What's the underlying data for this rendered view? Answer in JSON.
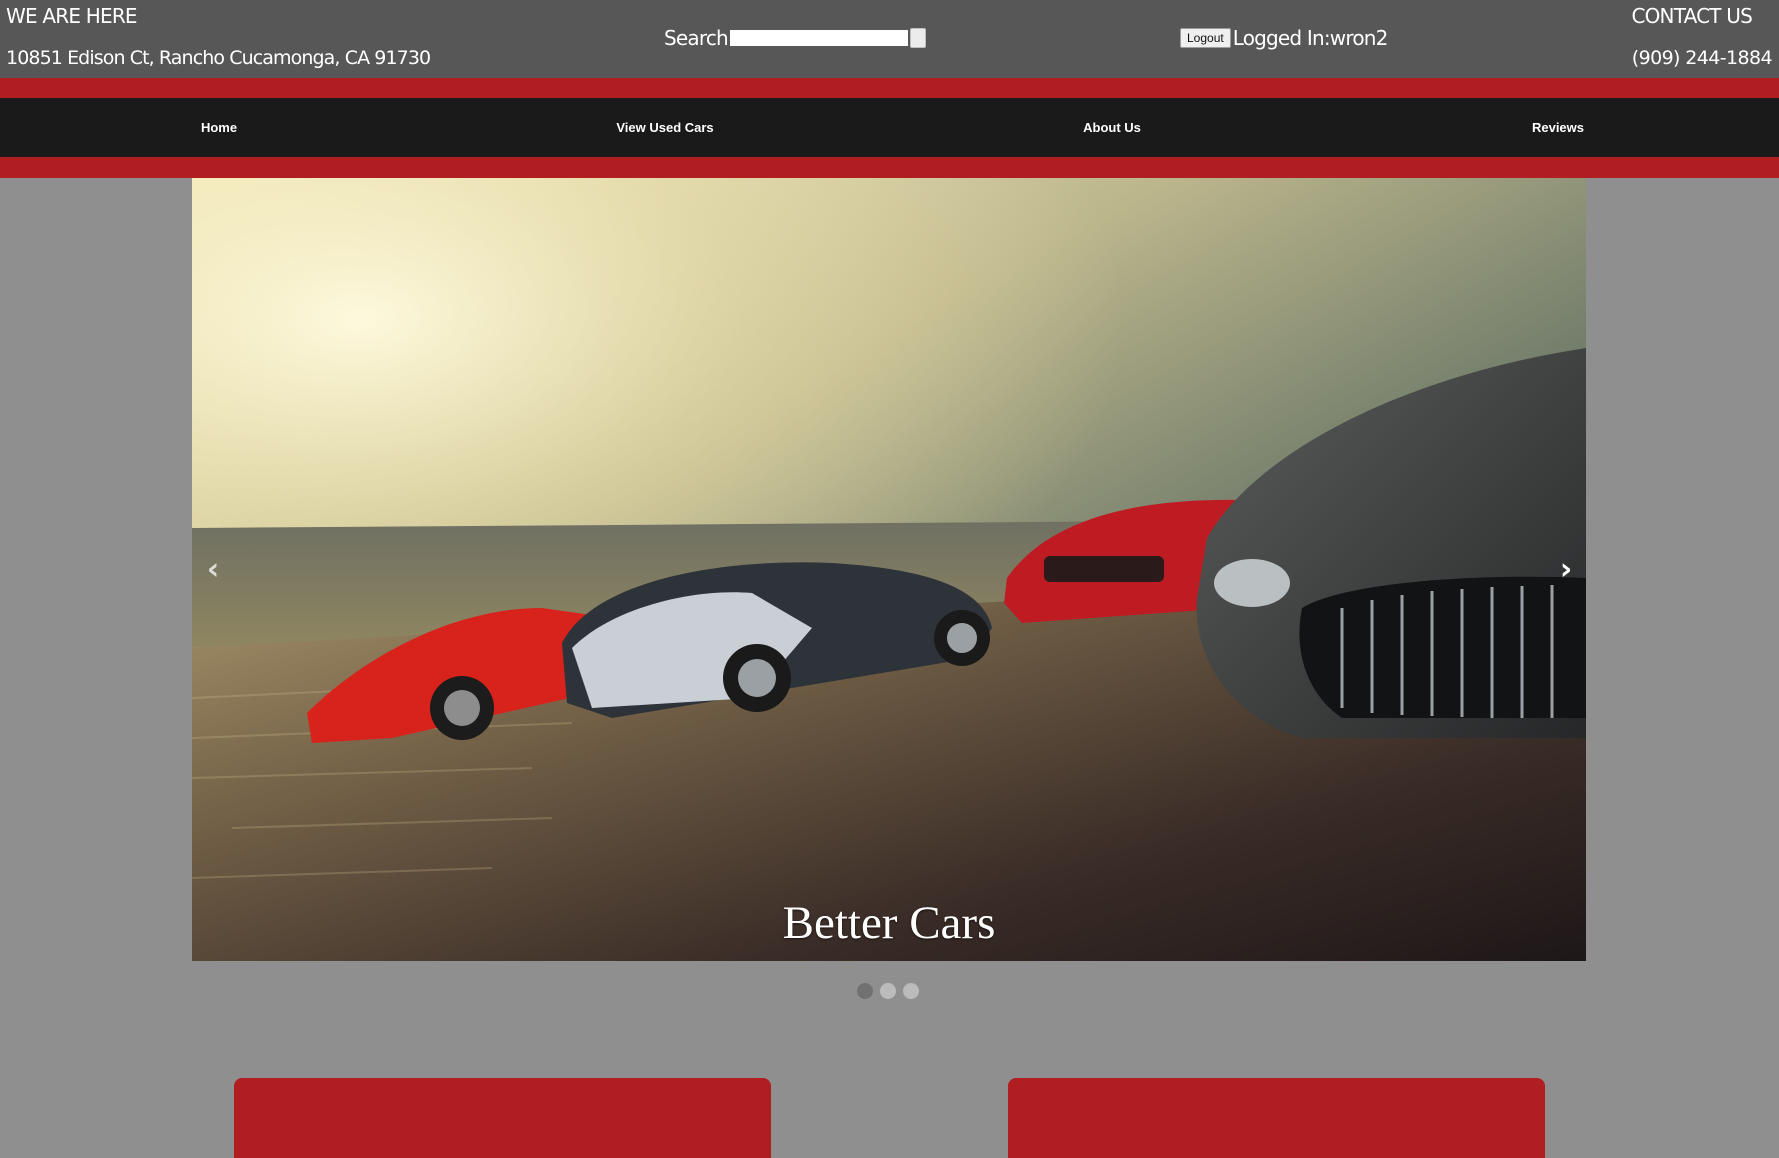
{
  "header": {
    "location_heading": "WE ARE HERE",
    "address": "10851 Edison Ct, Rancho Cucamonga, CA 91730",
    "search_label": "Search",
    "search_value": "",
    "logout_label": "Logout",
    "login_status": "Logged In:wron2",
    "contact_heading": "CONTACT US",
    "phone": "(909) 244-1884"
  },
  "nav": {
    "items": [
      {
        "label": "Home"
      },
      {
        "label": "View Used Cars"
      },
      {
        "label": "About Us"
      },
      {
        "label": "Reviews"
      }
    ]
  },
  "carousel": {
    "caption": "Better Cars",
    "prev_glyph": "‹",
    "next_glyph": "›",
    "slide_count": 3,
    "active_index": 0
  },
  "colors": {
    "header_bg": "#575757",
    "brand_red": "#b01e22",
    "nav_bg": "#1b1a1b",
    "page_bg": "#8f8f8f"
  }
}
